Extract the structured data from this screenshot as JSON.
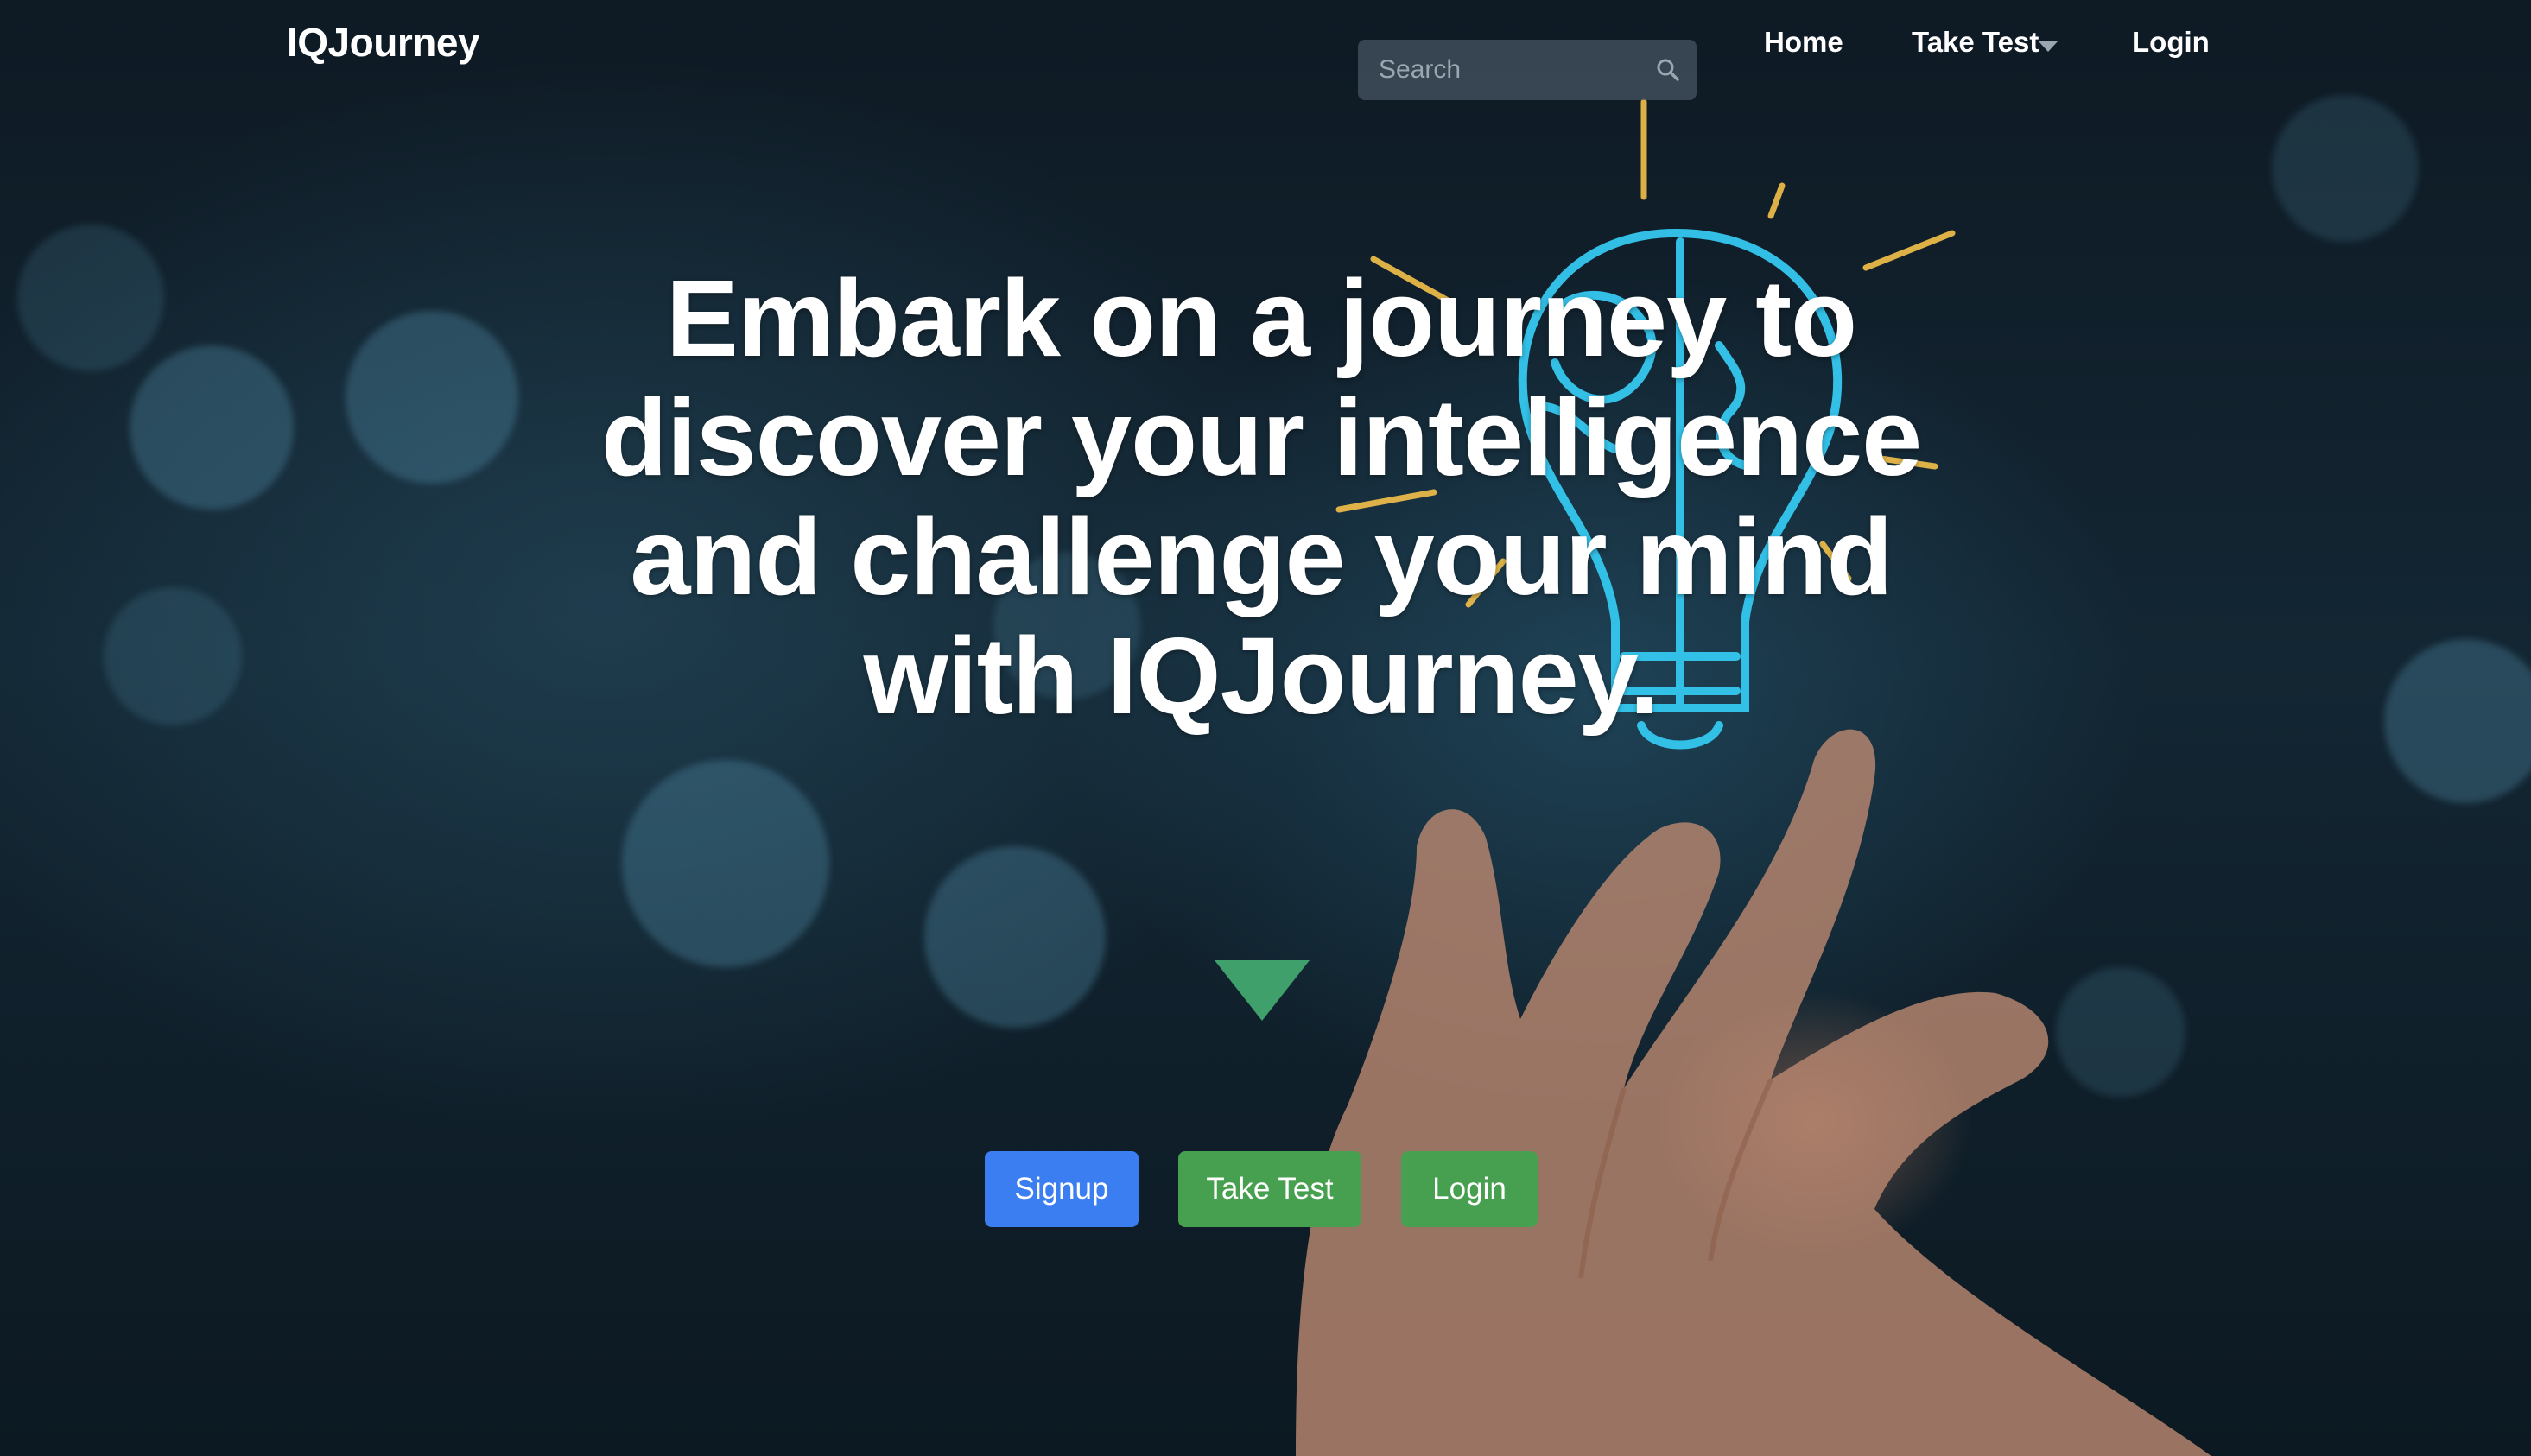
{
  "navbar": {
    "brand": "IQJourney",
    "search_placeholder": "Search",
    "links": {
      "home": "Home",
      "take_test": "Take Test",
      "login": "Login"
    }
  },
  "hero": {
    "headline": "Embark on a journey to discover your intelligence and challenge your mind with IQJourney.",
    "buttons": {
      "signup": "Signup",
      "take_test": "Take Test",
      "login": "Login"
    }
  },
  "colors": {
    "signup_button": "#3b7ef2",
    "green_buttons": "#47a04f",
    "arrow": "#3fa06c"
  },
  "icons": {
    "search": "search-icon",
    "dropdown": "caret-down-icon",
    "scroll": "down-arrow-icon",
    "bulb": "lightbulb-icon"
  }
}
